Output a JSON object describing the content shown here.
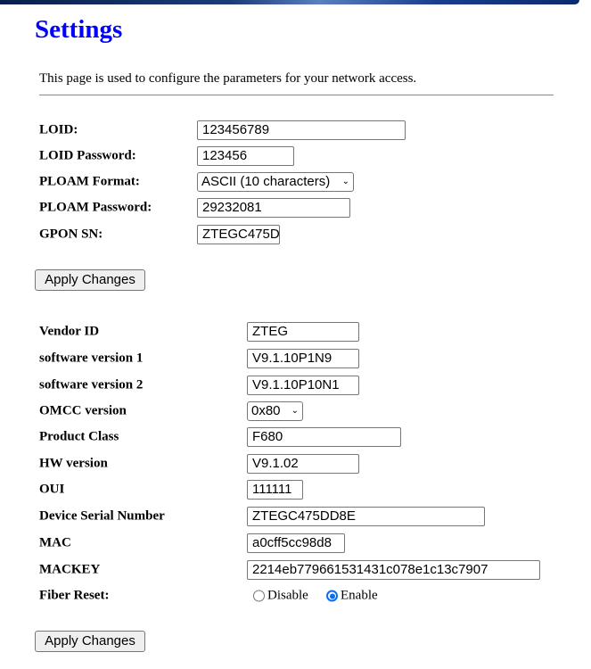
{
  "title": "Settings",
  "description": "This page is used to configure the parameters for your network access.",
  "gpon": {
    "loid_label": "LOID:",
    "loid": "123456789",
    "loid_password_label": "LOID Password:",
    "loid_password": "123456",
    "ploam_format_label": "PLOAM Format:",
    "ploam_format": "ASCII (10 characters)",
    "ploam_password_label": "PLOAM Password:",
    "ploam_password": "29232081",
    "gpon_sn_label": "GPON SN:",
    "gpon_sn": "ZTEGC475D",
    "apply_label": "Apply Changes"
  },
  "omci": {
    "vendor_id_label": "Vendor ID",
    "vendor_id": "ZTEG",
    "sw1_label": "software version 1",
    "sw1": "V9.1.10P1N9",
    "sw2_label": "software version 2",
    "sw2": "V9.1.10P10N1",
    "omcc_label": "OMCC version",
    "omcc": "0x80",
    "product_class_label": "Product Class",
    "product_class": "F680",
    "hw_label": "HW version",
    "hw": "V9.1.02",
    "oui_label": "OUI",
    "oui": "111111",
    "serial_label": "Device Serial Number",
    "serial": "ZTEGC475DD8E",
    "mac_label": "MAC",
    "mac": "a0cff5cc98d8",
    "mackey_label": "MACKEY",
    "mackey": "2214eb779661531431c078e1c13c7907",
    "fiber_reset_label": "Fiber Reset:",
    "fiber_reset_options": [
      "Disable",
      "Enable"
    ],
    "fiber_reset_selected": "Enable",
    "apply_label": "Apply Changes"
  },
  "colors": {
    "title": "#0000ff",
    "radio_accent": "#0a6cf5"
  }
}
